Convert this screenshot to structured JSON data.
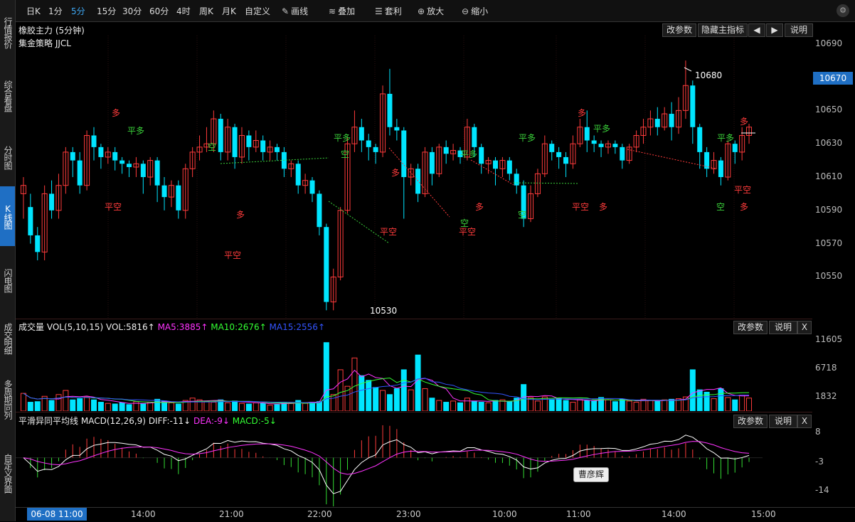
{
  "left_nav": [
    {
      "label": "行情报价",
      "active": false
    },
    {
      "label": "综合看盘",
      "active": false
    },
    {
      "label": "分时图",
      "active": false
    },
    {
      "label": "K线图",
      "active": true
    },
    {
      "label": "闪电图",
      "active": false
    },
    {
      "label": "成交明细",
      "active": false
    },
    {
      "label": "多周期同列",
      "active": false
    },
    {
      "label": "自定义界面",
      "active": false
    }
  ],
  "toolbar": {
    "periods": [
      "日K",
      "1分",
      "5分",
      "15分",
      "30分",
      "60分",
      "4时",
      "周K",
      "月K",
      "自定义"
    ],
    "active_period": "5分",
    "tools": [
      {
        "label": "画线",
        "icon": "pencil-icon"
      },
      {
        "label": "叠加",
        "icon": "stack-icon"
      },
      {
        "label": "套利",
        "icon": "arbitrage-icon"
      },
      {
        "label": "放大",
        "icon": "zoom-in-icon"
      },
      {
        "label": "缩小",
        "icon": "zoom-out-icon"
      }
    ]
  },
  "main_panel": {
    "title": "橡胶主力 (5分钟)",
    "strategy": "集金策略 JJCL",
    "buttons": {
      "params": "改参数",
      "hide": "隐藏主指标",
      "left": "◀",
      "right": "▶",
      "help": "说明"
    },
    "price_axis": [
      "10690",
      "10670",
      "10650",
      "10630",
      "10610",
      "10590",
      "10570",
      "10550"
    ],
    "current_price": "10670",
    "high_label": "10680",
    "low_label": "10530"
  },
  "volume_panel": {
    "title": "成交量",
    "indicator": "VOL(5,10,15)",
    "vol": "VOL:5816↑",
    "ma5": "MA5:3885↑",
    "ma10": "MA10:2676↑",
    "ma15": "MA15:2556↑",
    "axis": [
      "11605",
      "6718",
      "1832"
    ],
    "buttons": {
      "params": "改参数",
      "help": "说明",
      "close": "X"
    }
  },
  "macd_panel": {
    "title": "平滑异同平均线",
    "indicator": "MACD(12,26,9)",
    "diff": "DIFF:-11↓",
    "dea": "DEA:-9↓",
    "macd": "MACD:-5↓",
    "axis": [
      "8",
      "-3",
      "-14"
    ],
    "buttons": {
      "params": "改参数",
      "help": "说明",
      "close": "X"
    }
  },
  "time_axis": {
    "cursor_date": "06-08 11:00",
    "labels": [
      "14:00",
      "21:00",
      "22:00",
      "23:00",
      "10:00",
      "11:00",
      "14:00",
      "15:00"
    ]
  },
  "tooltip": "曹彦辉",
  "signals": [
    {
      "text": "多",
      "color": "red"
    },
    {
      "text": "平多",
      "color": "green"
    },
    {
      "text": "平空",
      "color": "red"
    },
    {
      "text": "空",
      "color": "green"
    },
    {
      "text": "平空",
      "color": "red"
    },
    {
      "text": "多",
      "color": "red"
    },
    {
      "text": "平多",
      "color": "green"
    },
    {
      "text": "空",
      "color": "green"
    },
    {
      "text": "多",
      "color": "red"
    },
    {
      "text": "平空",
      "color": "red"
    },
    {
      "text": "平多",
      "color": "green"
    },
    {
      "text": "空",
      "color": "green"
    },
    {
      "text": "平空",
      "color": "red"
    },
    {
      "text": "多",
      "color": "red"
    },
    {
      "text": "平多",
      "color": "green"
    },
    {
      "text": "空",
      "color": "green"
    },
    {
      "text": "多",
      "color": "red"
    },
    {
      "text": "平空",
      "color": "red"
    },
    {
      "text": "多",
      "color": "red"
    },
    {
      "text": "平多",
      "color": "green"
    },
    {
      "text": "多",
      "color": "red"
    },
    {
      "text": "平多",
      "color": "green"
    },
    {
      "text": "空",
      "color": "green"
    },
    {
      "text": "多",
      "color": "red"
    },
    {
      "text": "平空",
      "color": "red"
    }
  ],
  "colors": {
    "up": "#ff3b3b",
    "down": "#00e5ff",
    "bg": "#000000",
    "accent": "#1f6fc4",
    "ma5": "#ff33ff",
    "ma10": "#33ff33",
    "ma15": "#3355ff"
  },
  "chart_data": {
    "type": "candlestick",
    "ylim": [
      10525,
      10695
    ],
    "candles": [
      [
        10600,
        10605,
        10585,
        10610
      ],
      [
        10592,
        10575,
        10570,
        10600
      ],
      [
        10575,
        10565,
        10560,
        10580
      ],
      [
        10565,
        10600,
        10560,
        10605
      ],
      [
        10600,
        10590,
        10585,
        10608
      ],
      [
        10590,
        10605,
        10585,
        10612
      ],
      [
        10605,
        10625,
        10600,
        10628
      ],
      [
        10625,
        10620,
        10610,
        10628
      ],
      [
        10620,
        10605,
        10600,
        10625
      ],
      [
        10605,
        10635,
        10602,
        10638
      ],
      [
        10635,
        10628,
        10620,
        10640
      ],
      [
        10628,
        10622,
        10615,
        10630
      ],
      [
        10622,
        10625,
        10618,
        10628
      ],
      [
        10625,
        10620,
        10614,
        10628
      ],
      [
        10620,
        10618,
        10612,
        10622
      ],
      [
        10618,
        10616,
        10610,
        10620
      ],
      [
        10616,
        10618,
        10610,
        10622
      ],
      [
        10618,
        10610,
        10600,
        10620
      ],
      [
        10610,
        10620,
        10605,
        10622
      ],
      [
        10620,
        10605,
        10595,
        10622
      ],
      [
        10605,
        10598,
        10590,
        10610
      ],
      [
        10598,
        10605,
        10592,
        10608
      ],
      [
        10605,
        10590,
        10585,
        10608
      ],
      [
        10590,
        10615,
        10585,
        10618
      ],
      [
        10615,
        10625,
        10610,
        10628
      ],
      [
        10625,
        10628,
        10620,
        10635
      ],
      [
        10628,
        10630,
        10625,
        10640
      ],
      [
        10630,
        10645,
        10625,
        10650
      ],
      [
        10645,
        10625,
        10620,
        10648
      ],
      [
        10625,
        10640,
        10620,
        10645
      ],
      [
        10640,
        10622,
        10615,
        10642
      ],
      [
        10622,
        10635,
        10618,
        10640
      ],
      [
        10635,
        10628,
        10620,
        10638
      ],
      [
        10628,
        10632,
        10625,
        10638
      ],
      [
        10632,
        10625,
        10620,
        10635
      ],
      [
        10625,
        10628,
        10620,
        10632
      ],
      [
        10628,
        10625,
        10620,
        10630
      ],
      [
        10625,
        10615,
        10610,
        10628
      ],
      [
        10615,
        10618,
        10610,
        10620
      ],
      [
        10618,
        10605,
        10600,
        10620
      ],
      [
        10605,
        10608,
        10600,
        10612
      ],
      [
        10608,
        10600,
        10595,
        10610
      ],
      [
        10600,
        10580,
        10575,
        10602
      ],
      [
        10580,
        10535,
        10530,
        10582
      ],
      [
        10535,
        10550,
        10530,
        10555
      ],
      [
        10550,
        10590,
        10548,
        10592
      ],
      [
        10590,
        10630,
        10588,
        10634
      ],
      [
        10630,
        10640,
        10625,
        10650
      ],
      [
        10640,
        10632,
        10625,
        10645
      ],
      [
        10632,
        10628,
        10620,
        10636
      ],
      [
        10628,
        10625,
        10618,
        10630
      ],
      [
        10625,
        10660,
        10622,
        10665
      ],
      [
        10660,
        10640,
        10635,
        10675
      ],
      [
        10640,
        10638,
        10632,
        10645
      ],
      [
        10638,
        10610,
        10585,
        10640
      ],
      [
        10610,
        10615,
        10605,
        10618
      ],
      [
        10615,
        10600,
        10595,
        10618
      ],
      [
        10600,
        10625,
        10598,
        10628
      ],
      [
        10625,
        10612,
        10605,
        10628
      ],
      [
        10612,
        10628,
        10610,
        10630
      ],
      [
        10628,
        10624,
        10618,
        10632
      ],
      [
        10624,
        10626,
        10620,
        10630
      ],
      [
        10626,
        10622,
        10618,
        10628
      ],
      [
        10622,
        10640,
        10620,
        10645
      ],
      [
        10640,
        10628,
        10622,
        10642
      ],
      [
        10628,
        10618,
        10612,
        10630
      ],
      [
        10618,
        10620,
        10612,
        10622
      ],
      [
        10620,
        10615,
        10605,
        10622
      ],
      [
        10615,
        10620,
        10610,
        10622
      ],
      [
        10620,
        10612,
        10608,
        10622
      ],
      [
        10612,
        10605,
        10600,
        10615
      ],
      [
        10605,
        10585,
        10580,
        10608
      ],
      [
        10585,
        10600,
        10583,
        10605
      ],
      [
        10600,
        10612,
        10598,
        10615
      ],
      [
        10612,
        10630,
        10610,
        10635
      ],
      [
        10630,
        10625,
        10620,
        10632
      ],
      [
        10625,
        10622,
        10615,
        10628
      ],
      [
        10622,
        10618,
        10610,
        10625
      ],
      [
        10618,
        10630,
        10615,
        10635
      ],
      [
        10630,
        10640,
        10628,
        10645
      ],
      [
        10640,
        10632,
        10625,
        10650
      ],
      [
        10632,
        10630,
        10625,
        10635
      ],
      [
        10630,
        10628,
        10622,
        10632
      ],
      [
        10628,
        10630,
        10624,
        10632
      ],
      [
        10630,
        10628,
        10624,
        10632
      ],
      [
        10628,
        10620,
        10615,
        10630
      ],
      [
        10620,
        10628,
        10618,
        10630
      ],
      [
        10628,
        10635,
        10625,
        10638
      ],
      [
        10635,
        10640,
        10630,
        10645
      ],
      [
        10640,
        10645,
        10635,
        10650
      ],
      [
        10645,
        10640,
        10635,
        10652
      ],
      [
        10640,
        10648,
        10638,
        10652
      ],
      [
        10648,
        10640,
        10632,
        10655
      ],
      [
        10640,
        10650,
        10636,
        10658
      ],
      [
        10650,
        10665,
        10645,
        10680
      ],
      [
        10665,
        10640,
        10630,
        10668
      ],
      [
        10640,
        10625,
        10615,
        10642
      ],
      [
        10625,
        10615,
        10610,
        10628
      ],
      [
        10615,
        10620,
        10612,
        10625
      ],
      [
        10620,
        10610,
        10605,
        10622
      ],
      [
        10610,
        10630,
        10608,
        10632
      ],
      [
        10630,
        10625,
        10618,
        10632
      ],
      [
        10625,
        10635,
        10620,
        10640
      ],
      [
        10635,
        10640,
        10630,
        10642
      ]
    ],
    "volume": [
      3000,
      1500,
      1600,
      2500,
      1800,
      2800,
      3500,
      1900,
      2100,
      2400,
      1900,
      1500,
      1300,
      1200,
      1400,
      1100,
      1600,
      1200,
      1500,
      2000,
      1700,
      1400,
      1200,
      1800,
      2200,
      1900,
      1600,
      1500,
      1900,
      1400,
      1700,
      1300,
      1200,
      1400,
      1300,
      1000,
      1100,
      1500,
      1400,
      1800,
      1300,
      1500,
      1600,
      11605,
      2800,
      7000,
      4200,
      9000,
      6000,
      5200,
      4000,
      3500,
      2800,
      3800,
      7000,
      3600,
      9500,
      3800,
      2200,
      1800,
      1500,
      1700,
      1400,
      2200,
      1700,
      1500,
      1400,
      1800,
      1900,
      1600,
      2200,
      4500,
      2300,
      1700,
      2400,
      1900,
      2200,
      1800,
      1500,
      2000,
      1800,
      1700,
      2300,
      1900,
      1600,
      2000,
      1700,
      1500,
      2000,
      1800,
      1700,
      1900,
      2000,
      2100,
      2400,
      7000,
      3600,
      3200,
      2100,
      3800,
      2300,
      1900,
      2700,
      2200
    ],
    "macd_range": [
      -18,
      12
    ]
  }
}
